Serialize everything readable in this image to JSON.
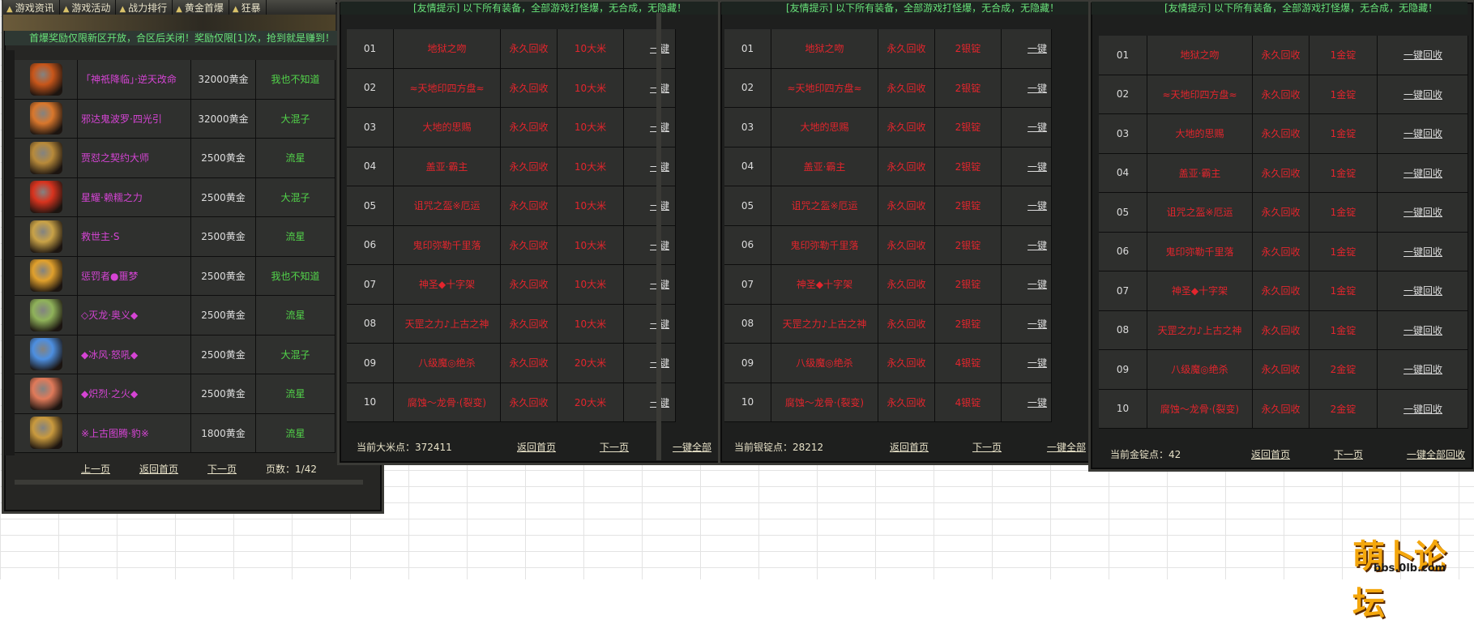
{
  "tabs": [
    "游戏资讯",
    "游戏活动",
    "战力排行",
    "黄金首爆",
    "狂暴"
  ],
  "notice_first_drop": "首爆奖励仅限新区开放，合区后关闭！奖励仅限[1]次，抢到就是赚到！",
  "notice_friendly": "[友情提示] 以下所有装备，全部游戏打怪爆，无合成，无隐藏！",
  "first_drop_items": [
    {
      "icon": "flame-knight-icon",
      "color": "#c8561a",
      "name": "「神祇降临」·逆天改命",
      "price": "32000黄金",
      "owner": "我也不知道"
    },
    {
      "icon": "fire-serpent-icon",
      "color": "#d9772c",
      "name": "邪达鬼波罗·四光引",
      "price": "32000黄金",
      "owner": "大混子"
    },
    {
      "icon": "demon-face-icon",
      "color": "#b88a3a",
      "name": "贾怼之契约大师",
      "price": "2500黄金",
      "owner": "流星"
    },
    {
      "icon": "crimson-flame-icon",
      "color": "#d8331e",
      "name": "星耀·赖糯之力",
      "price": "2500黄金",
      "owner": "大混子"
    },
    {
      "icon": "golden-mask-icon",
      "color": "#c9a247",
      "name": "救世主·S",
      "price": "2500黄金",
      "owner": "流星"
    },
    {
      "icon": "amber-orb-icon",
      "color": "#e0a02c",
      "name": "惩罚者●噩梦",
      "price": "2500黄金",
      "owner": "我也不知道"
    },
    {
      "icon": "green-star-icon",
      "color": "#8fb25a",
      "name": "◇灭龙·奥义◆",
      "price": "2500黄金",
      "owner": "流星"
    },
    {
      "icon": "ice-blade-icon",
      "color": "#4d8fe0",
      "name": "◆冰风·怒吼◆",
      "price": "2500黄金",
      "owner": "大混子"
    },
    {
      "icon": "fire-blade-icon",
      "color": "#e07a5a",
      "name": "◆炽烈·之火◆",
      "price": "2500黄金",
      "owner": "流星"
    },
    {
      "icon": "tiger-head-icon",
      "color": "#c99a3e",
      "name": "※上古图腾·豹※",
      "price": "1800黄金",
      "owner": "流星"
    }
  ],
  "pager": {
    "prev": "上一页",
    "home": "返回首页",
    "next": "下一页",
    "pages": "页数：1/42"
  },
  "recycle_items": [
    {
      "no": "01",
      "name": "地狱之吻",
      "dur": "永久回收"
    },
    {
      "no": "02",
      "name": "≈天地印四方盘≈",
      "dur": "永久回收"
    },
    {
      "no": "03",
      "name": "大地的思赐",
      "dur": "永久回收"
    },
    {
      "no": "04",
      "name": "盖亚·霸主",
      "dur": "永久回收"
    },
    {
      "no": "05",
      "name": "诅咒之盔※厄运",
      "dur": "永久回收"
    },
    {
      "no": "06",
      "name": "鬼印弥勒千里落",
      "dur": "永久回收"
    },
    {
      "no": "07",
      "name": "神圣◆十字架",
      "dur": "永久回收"
    },
    {
      "no": "08",
      "name": "天罡之力♪上古之神",
      "dur": "永久回收"
    },
    {
      "no": "09",
      "name": "八级魔◎绝杀",
      "dur": "永久回收"
    },
    {
      "no": "10",
      "name": "腐蚀～龙骨·(裂变)",
      "dur": "永久回收"
    }
  ],
  "wood_prices": [
    "10大米",
    "10大米",
    "10大米",
    "10大米",
    "10大米",
    "10大米",
    "10大米",
    "10大米",
    "20大米",
    "20大米"
  ],
  "silver_prices": [
    "2银锭",
    "2银锭",
    "2银锭",
    "2银锭",
    "2银锭",
    "2银锭",
    "2银锭",
    "2银锭",
    "4银锭",
    "4银锭"
  ],
  "gold_prices": [
    "1金锭",
    "1金锭",
    "1金锭",
    "1金锭",
    "1金锭",
    "1金锭",
    "1金锭",
    "1金锭",
    "2金锭",
    "2金锭"
  ],
  "action_short": "一键",
  "action_row": "一键回收",
  "footer": {
    "wood_label": "当前大米点：372411",
    "silver_label": "当前银锭点：28212",
    "gold_label": "当前金锭点：42",
    "home": "返回首页",
    "next": "下一页",
    "all": "一键全部",
    "all_full": "一键全部回收"
  },
  "watermark": {
    "cn": "萌卜论坛",
    "url": "bbs.0lb.com"
  },
  "colors": {
    "name_purple": "#d544d4",
    "owner_green": "#52d44a",
    "recycle_red": "#e4252d",
    "notice_green": "#69e37a"
  }
}
